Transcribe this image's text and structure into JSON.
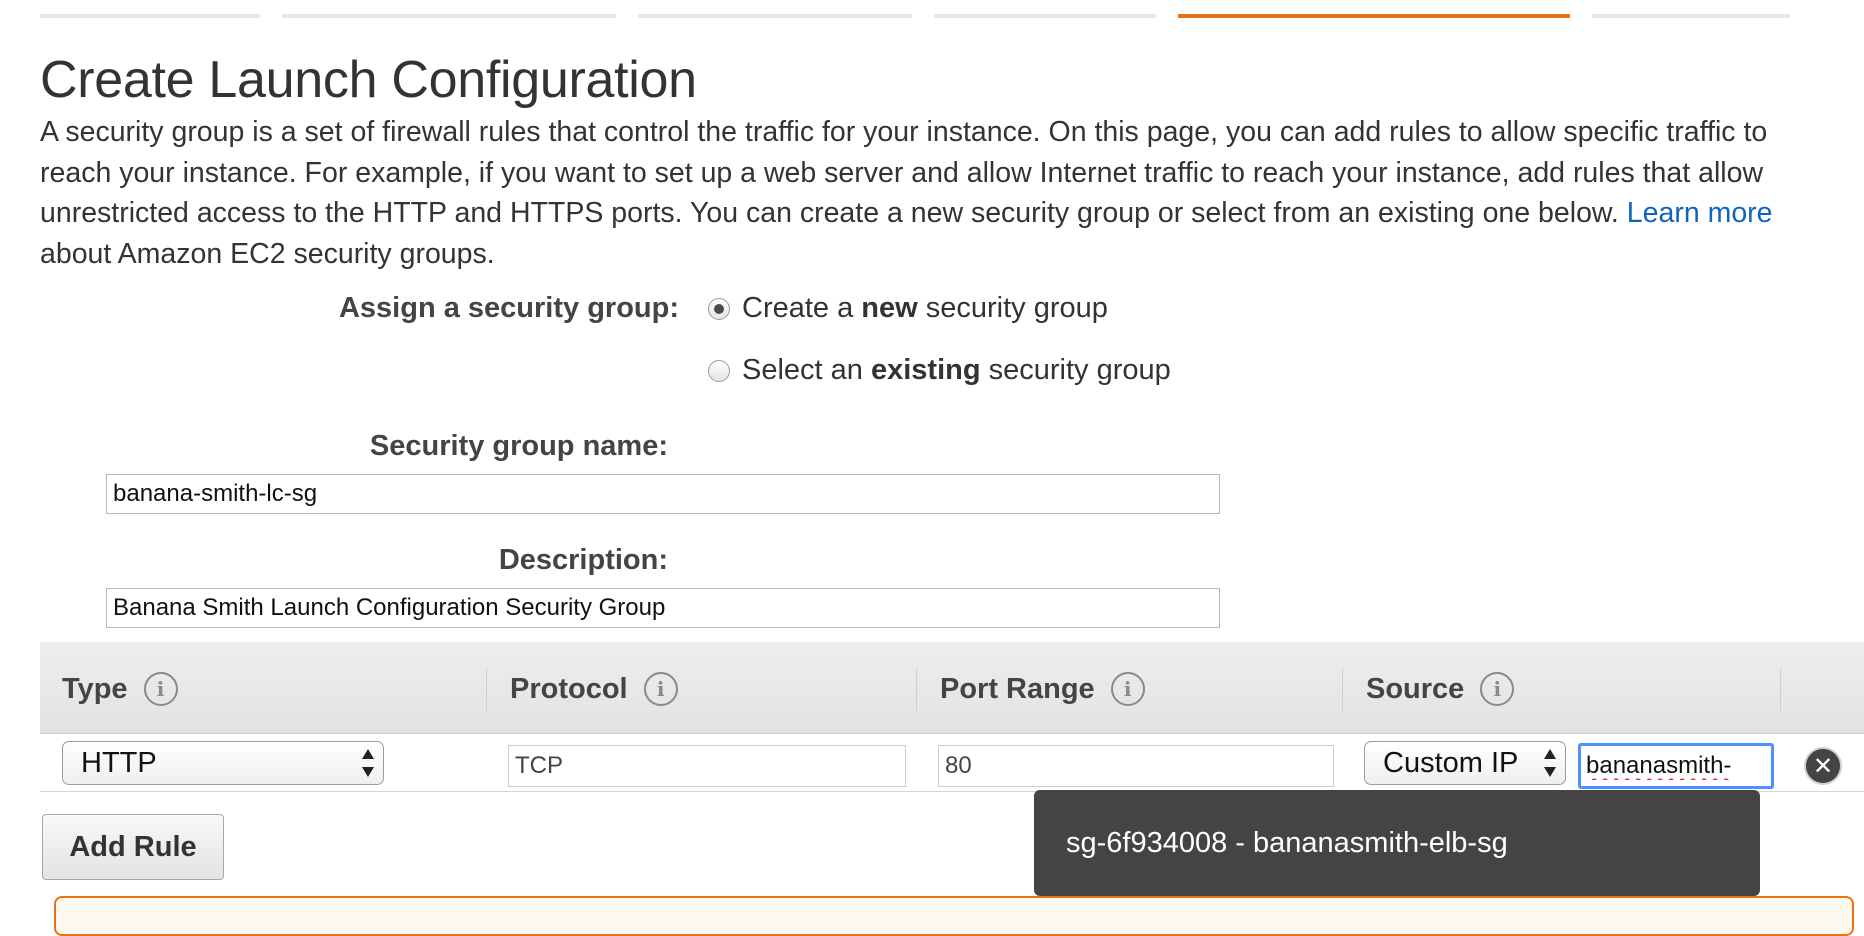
{
  "colors": {
    "accent": "#ec7211",
    "link": "#1166bb",
    "popup_bg": "#444444",
    "focus": "#4d90fe"
  },
  "page": {
    "title": "Create Launch Configuration",
    "intro": {
      "text": "A security group is a set of firewall rules that control the traffic for your instance. On this page, you can add rules to allow specific traffic to reach your instance. For example, if you want to set up a web server and allow Internet traffic to reach your instance, add rules that allow unrestricted access to the HTTP and HTTPS ports. You can create a new security group or select from an existing one below.",
      "link": "Learn more",
      "after_link": "about Amazon EC2 security groups."
    }
  },
  "assign": {
    "label": "Assign a security group:",
    "options": [
      {
        "pre": "Create a ",
        "bold": "new",
        "post": " security group",
        "checked": true
      },
      {
        "pre": "Select an ",
        "bold": "existing",
        "post": " security group",
        "checked": false
      }
    ]
  },
  "form": {
    "name_label": "Security group name:",
    "name_value": "banana-smith-lc-sg",
    "description_label": "Description:",
    "description_value": "Banana Smith Launch Configuration Security Group"
  },
  "rules": {
    "columns": [
      "Type",
      "Protocol",
      "Port Range",
      "Source"
    ],
    "row": {
      "type": "HTTP",
      "protocol": "TCP",
      "port_range": "80",
      "source_type": "Custom IP",
      "source_value": "bananasmith-"
    },
    "add_rule_label": "Add Rule"
  },
  "suggestion": {
    "text": "sg-6f934008 - bananasmith-elb-sg"
  },
  "icons": {
    "info": "info-icon",
    "remove": "remove-rule-icon",
    "select": "select-arrows-icon"
  }
}
